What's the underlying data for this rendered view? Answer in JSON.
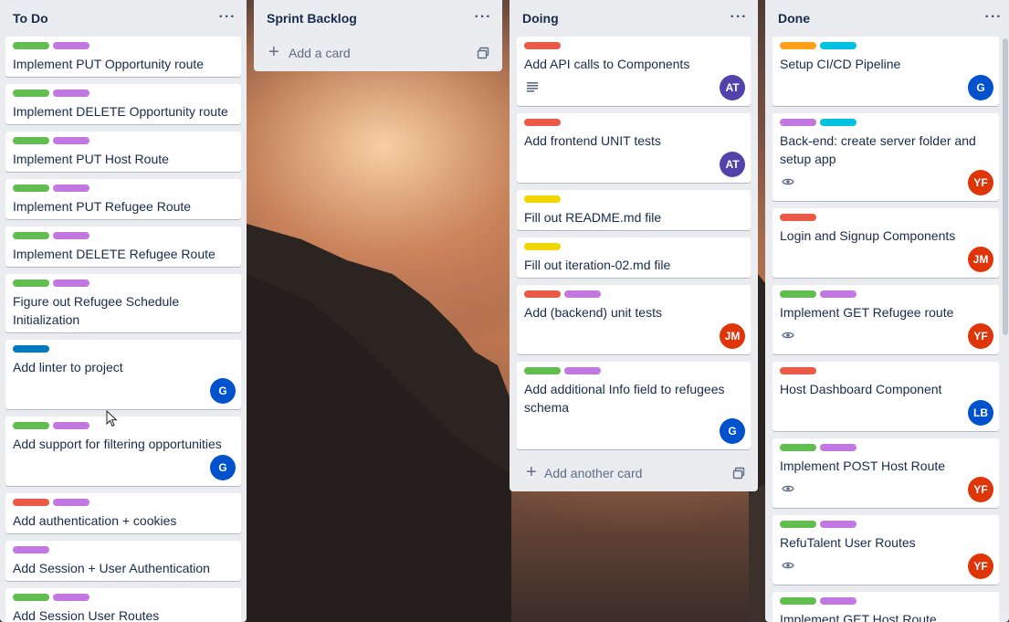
{
  "colors": {
    "label_green": "#61bd4f",
    "label_purple": "#c377e0",
    "label_red": "#eb5a46",
    "label_blue": "#0079bf",
    "label_yellow": "#f2d600",
    "label_orange": "#ff9f1a",
    "label_sky": "#00c2e0",
    "avatar_at": "#5243aa",
    "avatar_g": "#0052cc",
    "avatar_yf": "#de350b",
    "avatar_jm": "#de350b",
    "avatar_lb": "#0052cc"
  },
  "lists": [
    {
      "title": "To Do",
      "menu": "···",
      "cards": [
        {
          "labels": [
            "green",
            "purple"
          ],
          "title": "Implement PUT Opportunity route"
        },
        {
          "labels": [
            "green",
            "purple"
          ],
          "title": "Implement DELETE Opportunity route"
        },
        {
          "labels": [
            "green",
            "purple"
          ],
          "title": "Implement PUT Host Route"
        },
        {
          "labels": [
            "green",
            "purple"
          ],
          "title": "Implement PUT Refugee Route"
        },
        {
          "labels": [
            "green",
            "purple"
          ],
          "title": "Implement DELETE Refugee Route"
        },
        {
          "labels": [
            "green",
            "purple"
          ],
          "title": "Figure out Refugee Schedule Initialization"
        },
        {
          "labels": [
            "blue"
          ],
          "title": "Add linter to project",
          "avatar": "G"
        },
        {
          "labels": [
            "green",
            "purple"
          ],
          "title": "Add support for filtering opportunities",
          "avatar": "G"
        },
        {
          "labels": [
            "red",
            "purple"
          ],
          "title": "Add authentication + cookies"
        },
        {
          "labels": [
            "purple"
          ],
          "title": "Add Session + User Authentication"
        },
        {
          "labels": [
            "green",
            "purple"
          ],
          "title": "Add Session User Routes"
        }
      ]
    },
    {
      "title": "Sprint Backlog",
      "menu": "···",
      "add_card": "Add a card",
      "cards": []
    },
    {
      "title": "Doing",
      "menu": "···",
      "add_card": "Add another card",
      "cards": [
        {
          "labels": [
            "red"
          ],
          "title": "Add API calls to Components",
          "description_icon": "description-icon",
          "avatar": "AT"
        },
        {
          "labels": [
            "red"
          ],
          "title": "Add frontend UNIT tests",
          "avatar": "AT"
        },
        {
          "labels": [
            "yellow"
          ],
          "title": "Fill out README.md file"
        },
        {
          "labels": [
            "yellow"
          ],
          "title": "Fill out iteration-02.md file"
        },
        {
          "labels": [
            "red",
            "purple"
          ],
          "title": "Add (backend) unit tests",
          "avatar": "JM"
        },
        {
          "labels": [
            "green",
            "purple"
          ],
          "title": "Add additional Info field to refugees schema",
          "avatar": "G"
        }
      ]
    },
    {
      "title": "Done",
      "menu": "···",
      "cards": [
        {
          "labels": [
            "orange",
            "sky"
          ],
          "title": "Setup CI/CD Pipeline",
          "avatar": "G"
        },
        {
          "labels": [
            "purple",
            "sky"
          ],
          "title": "Back-end: create server folder and setup app",
          "watch_icon": "eye-icon",
          "avatar": "YF"
        },
        {
          "labels": [
            "red"
          ],
          "title": "Login and Signup Components",
          "avatar": "JM"
        },
        {
          "labels": [
            "green",
            "purple"
          ],
          "title": "Implement GET Refugee route",
          "watch_icon": "eye-icon",
          "avatar": "YF"
        },
        {
          "labels": [
            "red"
          ],
          "title": "Host Dashboard Component",
          "avatar": "LB"
        },
        {
          "labels": [
            "green",
            "purple"
          ],
          "title": "Implement POST Host Route",
          "watch_icon": "eye-icon",
          "avatar": "YF"
        },
        {
          "labels": [
            "green",
            "purple"
          ],
          "title": "RefuTalent User Routes",
          "watch_icon": "eye-icon",
          "avatar": "YF"
        },
        {
          "labels": [
            "green",
            "purple"
          ],
          "title": "Implement GET Host Route"
        }
      ]
    }
  ]
}
